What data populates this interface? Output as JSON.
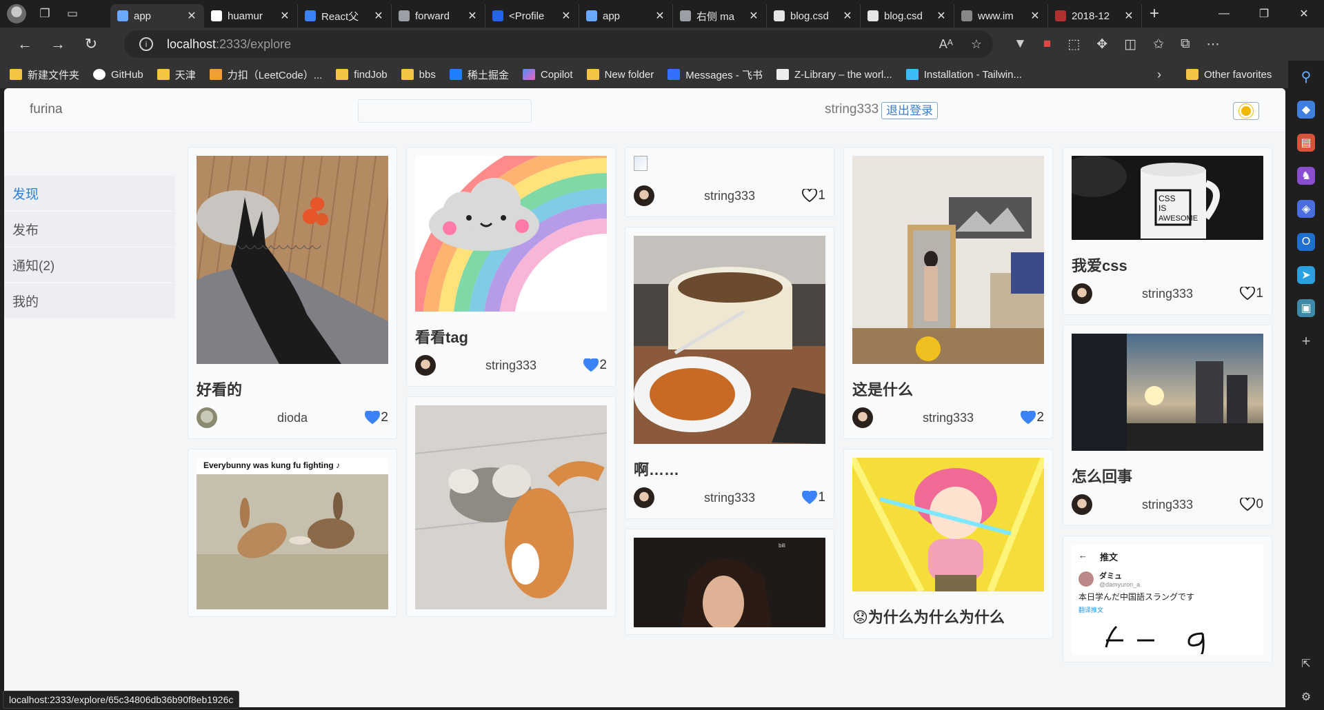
{
  "browser": {
    "tabs": [
      {
        "label": "app",
        "active": true,
        "favicon_color": "#6aa7ff"
      },
      {
        "label": "huamur",
        "favicon_color": "#ffffff"
      },
      {
        "label": "React父",
        "favicon_color": "#3b82f6"
      },
      {
        "label": "forward",
        "favicon_color": "#9aa0a6"
      },
      {
        "label": "<Profile",
        "favicon_color": "#2563eb"
      },
      {
        "label": "app",
        "favicon_color": "#6aa7ff"
      },
      {
        "label": "右侧 ma",
        "favicon_color": "#9aa0a6"
      },
      {
        "label": "blog.csd",
        "favicon_color": "#e5e5e5"
      },
      {
        "label": "blog.csd",
        "favicon_color": "#e5e5e5"
      },
      {
        "label": "www.im",
        "favicon_color": "#888888"
      },
      {
        "label": "2018-12",
        "favicon_color": "#b03030"
      }
    ],
    "url_host": "localhost",
    "url_path": ":2333/explore",
    "favorites": [
      {
        "label": "新建文件夹",
        "icon": "folder-icon"
      },
      {
        "label": "GitHub",
        "icon": "github-icon"
      },
      {
        "label": "天津",
        "icon": "folder-icon"
      },
      {
        "label": "力扣（LeetCode）...",
        "icon": "leetcode-icon"
      },
      {
        "label": "findJob",
        "icon": "folder-icon"
      },
      {
        "label": "bbs",
        "icon": "folder-icon"
      },
      {
        "label": "稀土掘金",
        "icon": "juejin-icon"
      },
      {
        "label": "Copilot",
        "icon": "copilot-icon"
      },
      {
        "label": "New folder",
        "icon": "folder-icon"
      },
      {
        "label": "Messages - 飞书",
        "icon": "feishu-icon"
      },
      {
        "label": "Z-Library – the worl...",
        "icon": "zlibrary-icon"
      },
      {
        "label": "Installation - Tailwin...",
        "icon": "tailwind-icon"
      }
    ],
    "other_favorites": "Other favorites",
    "status_url": "localhost:2333/explore/65c34806db36b90f8eb1926c"
  },
  "app": {
    "brand": "furina",
    "username": "string333",
    "logout_label": "退出登录",
    "nav": [
      {
        "label": "发现",
        "active": true
      },
      {
        "label": "发布"
      },
      {
        "label": "通知(2)"
      },
      {
        "label": "我的"
      }
    ]
  },
  "columns": [
    [
      {
        "image": "hand-lace-glove",
        "img_h": 302,
        "title": "好看的",
        "user": "dioda",
        "likes": "2",
        "liked": true
      },
      {
        "image": "kung-fu-bunnies",
        "img_h": 220,
        "caption": "Everybunny was kung fu fighting ♪",
        "title": "",
        "user": "",
        "likes": "",
        "cut": true
      }
    ],
    [
      {
        "image": "cloud-rainbow",
        "img_h": 226,
        "title": "看看tag",
        "user": "string333",
        "likes": "2",
        "liked": true
      },
      {
        "image": "cats-fighting",
        "img_h": 296,
        "title": "",
        "user": "",
        "likes": "",
        "cut": true
      }
    ],
    [
      {
        "image": "broken",
        "img_h": 28,
        "title": "",
        "user": "string333",
        "likes": "1",
        "liked": false
      },
      {
        "image": "food-pot",
        "img_h": 302,
        "title": "啊……",
        "user": "string333",
        "likes": "1",
        "liked": true
      },
      {
        "image": "girl-screenshot",
        "img_h": 130,
        "title": "",
        "user": "",
        "likes": "",
        "cut": true
      }
    ],
    [
      {
        "image": "mirror-room",
        "img_h": 302,
        "title": "这是什么",
        "user": "string333",
        "likes": "2",
        "liked": true
      },
      {
        "image": "anime-girl",
        "img_h": 194,
        "title": "😟为什么为什么为什么",
        "user": "",
        "likes": "",
        "cut": true
      }
    ],
    [
      {
        "image": "css-mug",
        "img_h": 122,
        "title": "我爱css",
        "user": "string333",
        "likes": "1",
        "liked": false
      },
      {
        "image": "sunset-buildings",
        "img_h": 170,
        "title": "怎么回事",
        "user": "string333",
        "likes": "0",
        "liked": false
      },
      {
        "image": "tweet-screenshot",
        "img_h": 160,
        "title": "",
        "user": "",
        "likes": "",
        "cut": true
      }
    ]
  ],
  "tweet": {
    "header": "推文",
    "name": "ダミュ",
    "handle": "@damyuron_a",
    "text": "本日学んだ中国語スラングです",
    "translate": "翻译推文"
  },
  "colors": {
    "accent": "#2f7fd6",
    "heart_fill": "#3b82f6",
    "page_bg": "#f3f5f7"
  }
}
